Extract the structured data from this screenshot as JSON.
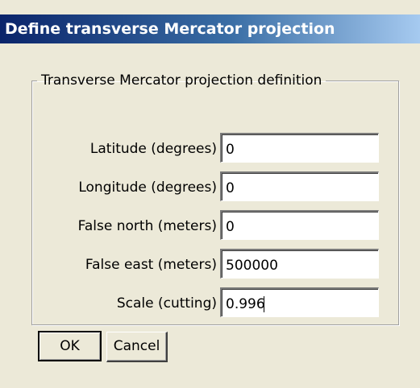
{
  "dialog": {
    "title": "Define transverse Mercator projection"
  },
  "group": {
    "legend": "Transverse Mercator projection definition"
  },
  "fields": [
    {
      "label": "Latitude (degrees)",
      "value": "0"
    },
    {
      "label": "Longitude (degrees)",
      "value": "0"
    },
    {
      "label": "False north (meters)",
      "value": "0"
    },
    {
      "label": "False east (meters)",
      "value": "500000"
    },
    {
      "label": "Scale (cutting)",
      "value": "0.996"
    }
  ],
  "buttons": {
    "ok": "OK",
    "cancel": "Cancel"
  }
}
